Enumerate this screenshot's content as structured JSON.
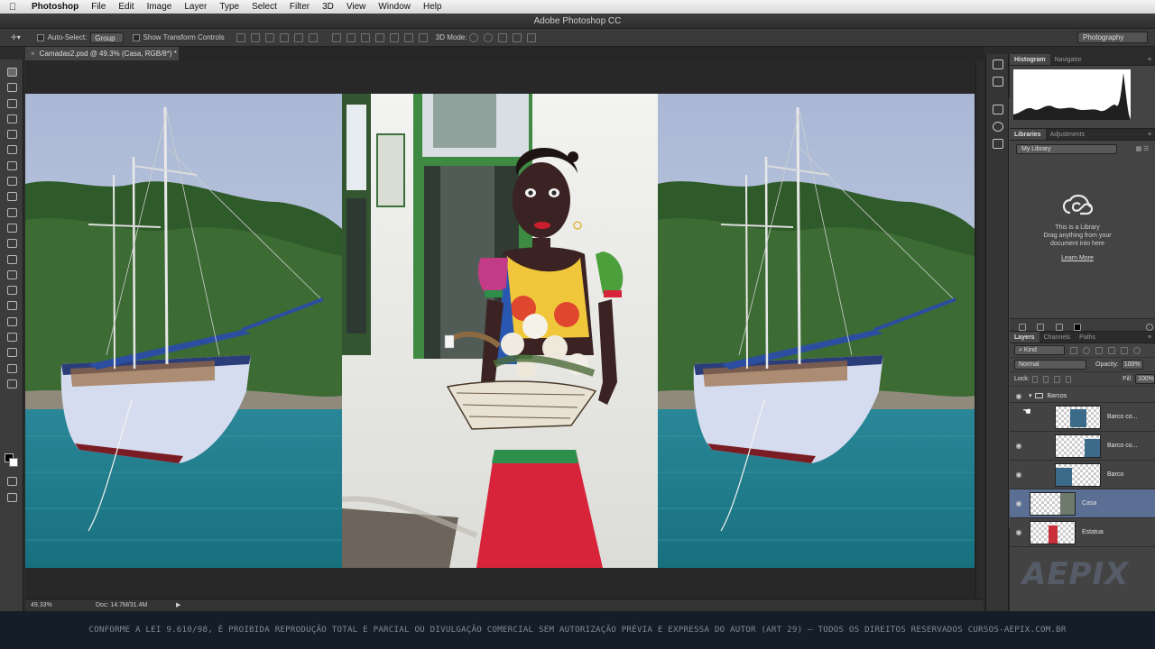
{
  "menubar": {
    "items": [
      "Photoshop",
      "File",
      "Edit",
      "Image",
      "Layer",
      "Type",
      "Select",
      "Filter",
      "3D",
      "View",
      "Window",
      "Help"
    ]
  },
  "window": {
    "title": "Adobe Photoshop CC"
  },
  "options": {
    "auto_select_label": "Auto-Select:",
    "auto_select_value": "Group",
    "transform_label": "Show Transform Controls",
    "mode_3d_label": "3D Mode:",
    "workspace": "Photography"
  },
  "document": {
    "tab_close": "×",
    "tab_label": "Camadas2.psd @ 49.3% (Casa, RGB/8*) *"
  },
  "status": {
    "zoom": "49.33%",
    "docsize": "Doc: 14.7M/31.4M",
    "arrow": "▶"
  },
  "panels": {
    "top_tabs": [
      "Histogram",
      "Navigator"
    ],
    "mid_tabs": [
      "Libraries",
      "Adjustments"
    ],
    "library_select": "My Library",
    "library_text_1": "This is a Library",
    "library_text_2": "Drag anything from your",
    "library_text_3": "document into here",
    "library_link": "Learn More",
    "layer_tabs": [
      "Layers",
      "Channels",
      "Paths"
    ],
    "kind_filter": "Kind",
    "blend_mode": "Normal",
    "opacity_label": "Opacity:",
    "opacity_value": "100%",
    "lock_label": "Lock:",
    "fill_label": "Fill:",
    "fill_value": "100%",
    "group_name": "Barcos",
    "layers": [
      {
        "name": "Barco co...",
        "visible": false
      },
      {
        "name": "Barco co...",
        "visible": true
      },
      {
        "name": "Barco",
        "visible": true
      },
      {
        "name": "Casa",
        "visible": true,
        "active": true
      },
      {
        "name": "Estatua",
        "visible": true
      }
    ]
  },
  "footer": {
    "copyright": "CONFORME A LEI 9.610/98, É PROIBIDA REPRODUÇÃO TOTAL E PARCIAL OU DIVULGAÇÃO COMERCIAL SEM AUTORIZAÇÃO PRÉVIA E EXPRESSA DO AUTOR (ART 29) – TODOS OS DIREITOS RESERVADOS CURSOS-AEPIX.COM.BR",
    "watermark": "AEPIX"
  },
  "colors": {
    "accent_selected_layer": "#5a6f93",
    "sea": "#1f7f8f",
    "dress_red": "#d8243a"
  }
}
